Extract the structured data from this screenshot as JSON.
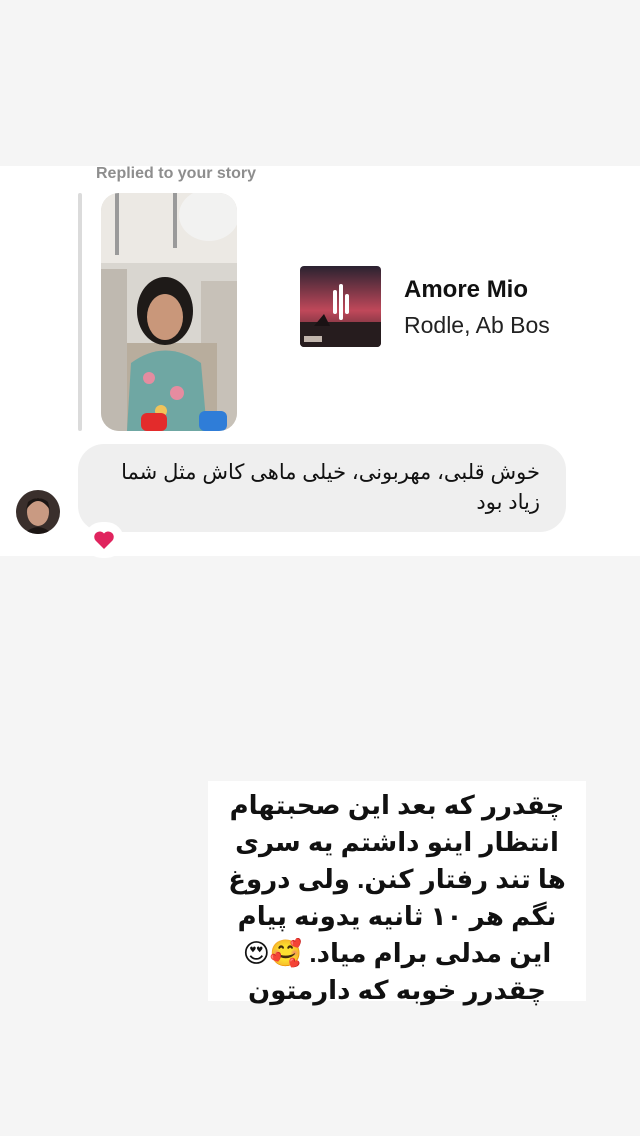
{
  "story_reply": {
    "replied_label": "Replied to your story"
  },
  "music": {
    "title": "Amore Mio",
    "artist": "Rodle, Ab Bos"
  },
  "message": {
    "text": "خوش قلبی، مهربونی، خیلی ماهی کاش مثل شما زیاد بود",
    "reaction": "❤️"
  },
  "caption": {
    "text": "چقدرر که بعد این صحبتهام انتظار اینو داشتم یه سری ها تند رفتار کنن. ولی دروغ نگم هر ۱۰ ثانیه یدونه پیام این مدلی برام میاد. 🥰😍چقدرر خوبه که دارمتون"
  },
  "colors": {
    "bubble": "#efefef",
    "muted_text": "#8e8e8e",
    "heart": "#e0245e"
  }
}
